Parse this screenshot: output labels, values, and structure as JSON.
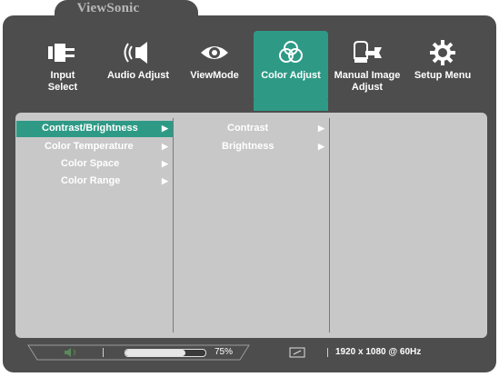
{
  "brand": "ViewSonic",
  "menu": {
    "tabs": [
      {
        "id": "input",
        "label_line1": "Input",
        "label_line2": "Select",
        "icon": "input-select-icon"
      },
      {
        "id": "audio",
        "label_line1": "Audio Adjust",
        "label_line2": "",
        "icon": "speaker-icon"
      },
      {
        "id": "viewmode",
        "label_line1": "ViewMode",
        "label_line2": "",
        "icon": "eye-icon"
      },
      {
        "id": "color",
        "label_line1": "Color Adjust",
        "label_line2": "",
        "icon": "color-circles-icon"
      },
      {
        "id": "manual",
        "label_line1": "Manual Image",
        "label_line2": "Adjust",
        "icon": "wrench-icon"
      },
      {
        "id": "setup",
        "label_line1": "Setup Menu",
        "label_line2": "",
        "icon": "gear-icon"
      }
    ],
    "active_tab": "Color Adjust"
  },
  "level1": {
    "items": [
      {
        "label": "Contrast/Brightness",
        "selected": true
      },
      {
        "label": "Color Temperature",
        "selected": false
      },
      {
        "label": "Color Space",
        "selected": false
      },
      {
        "label": "Color Range",
        "selected": false
      }
    ]
  },
  "level2": {
    "items": [
      {
        "label": "Contrast"
      },
      {
        "label": "Brightness"
      }
    ]
  },
  "status": {
    "volume_percent": 75,
    "volume_label": "75%",
    "resolution": "1920 x 1080 @ 60Hz"
  },
  "colors": {
    "accent": "#2e9a86",
    "frame": "#4d4d4d",
    "panel": "#c8c8c8"
  }
}
